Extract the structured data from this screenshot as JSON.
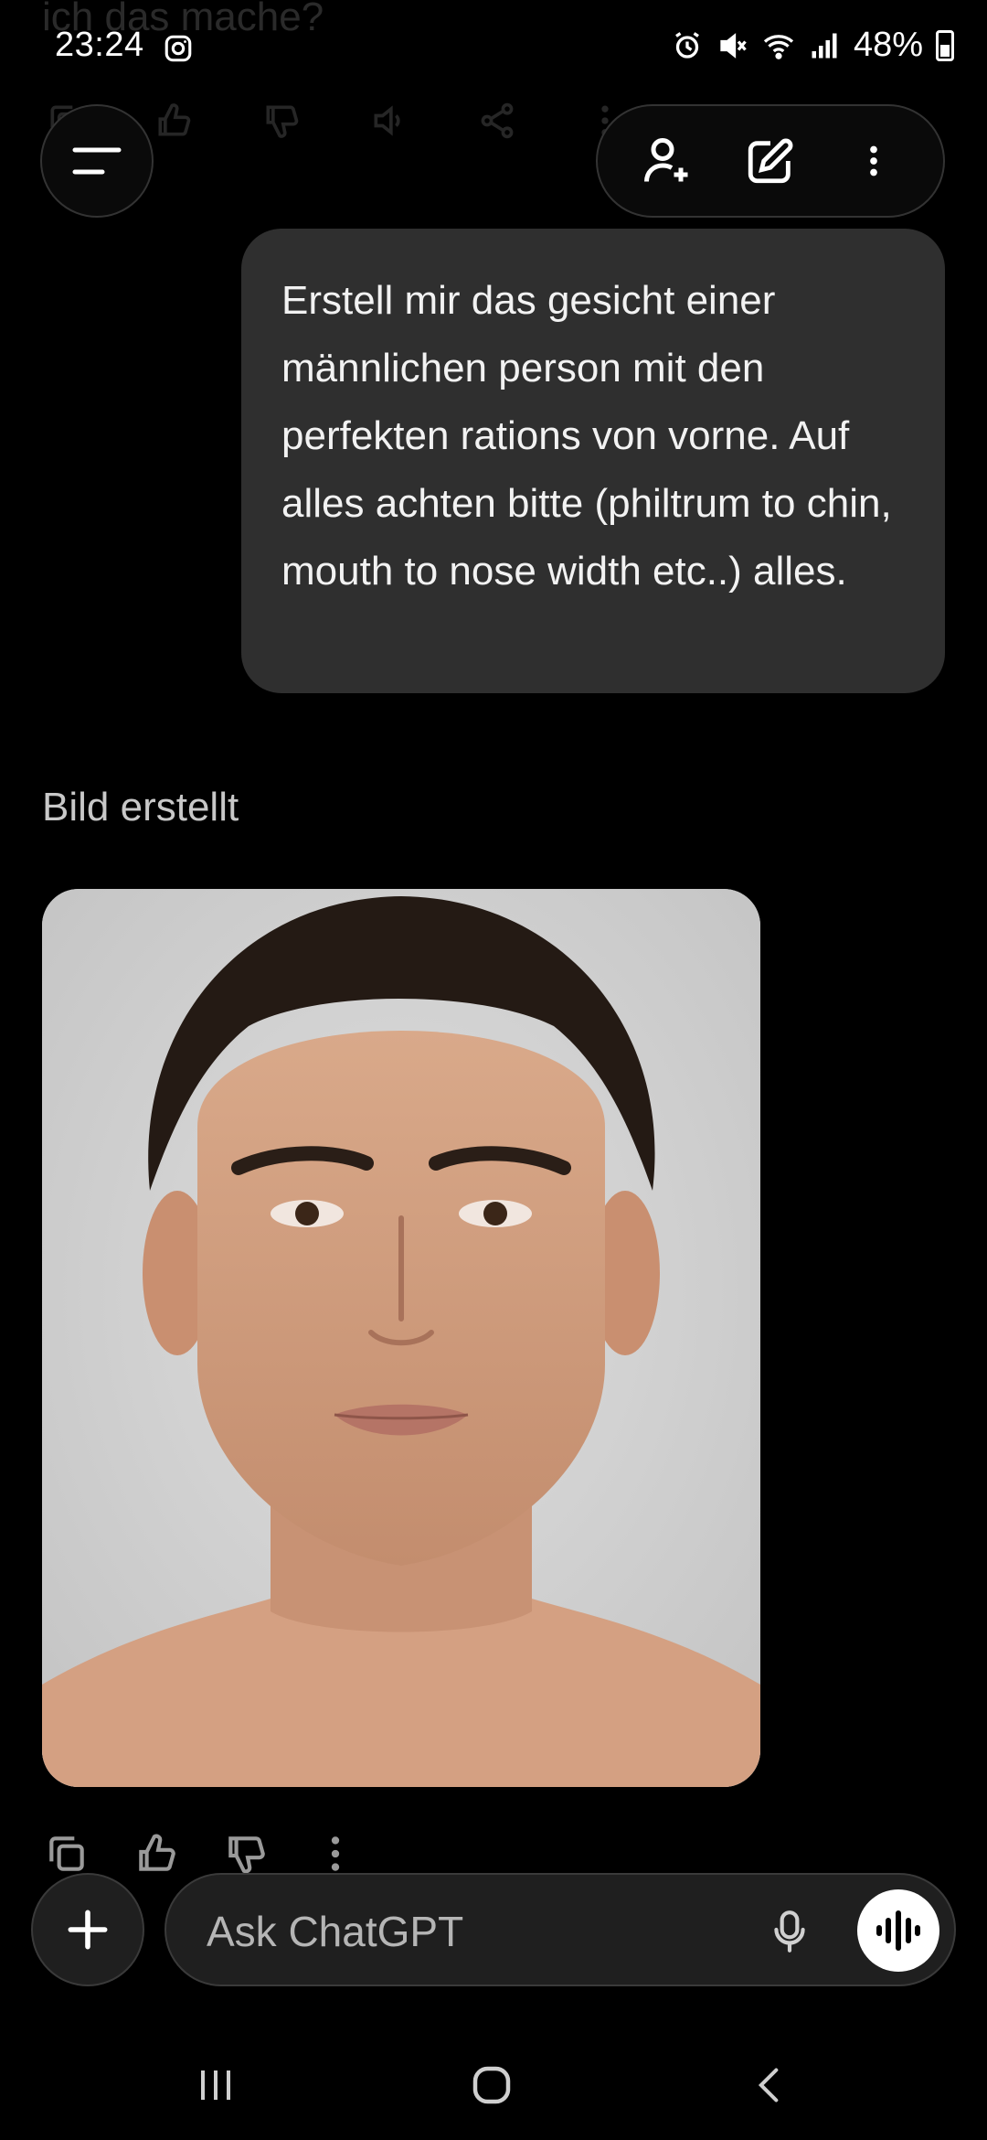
{
  "background_previous": {
    "message_tail": "ich das mache?"
  },
  "statusbar": {
    "time": "23:24",
    "battery_text": "48%",
    "icons": [
      "instagram-icon",
      "alarm-icon",
      "mute-icon",
      "wifi-icon",
      "signal-icon",
      "battery-icon"
    ]
  },
  "header": {
    "menu_icon": "menu-icon",
    "actions": [
      "add-person-icon",
      "edit-icon",
      "more-vertical-icon"
    ]
  },
  "conversation": {
    "user_message": "Erstell mir das gesicht einer männlichen person mit den perfekten rations von vorne. Auf alles achten bitte (philtrum to chin, mouth to nose width etc..) alles.",
    "image_label": "Bild erstellt",
    "image_alt": "Generated portrait",
    "actions": [
      "copy-icon",
      "thumbs-up-icon",
      "thumbs-down-icon",
      "more-vertical-icon"
    ]
  },
  "composer": {
    "placeholder": "Ask ChatGPT",
    "value": ""
  },
  "navbar": {
    "buttons": [
      "recents",
      "home",
      "back"
    ]
  },
  "colors": {
    "background": "#000000",
    "bubble": "#2f2f2f",
    "composer": "#1f1f1f",
    "image_bg": "#d3d3d3"
  }
}
